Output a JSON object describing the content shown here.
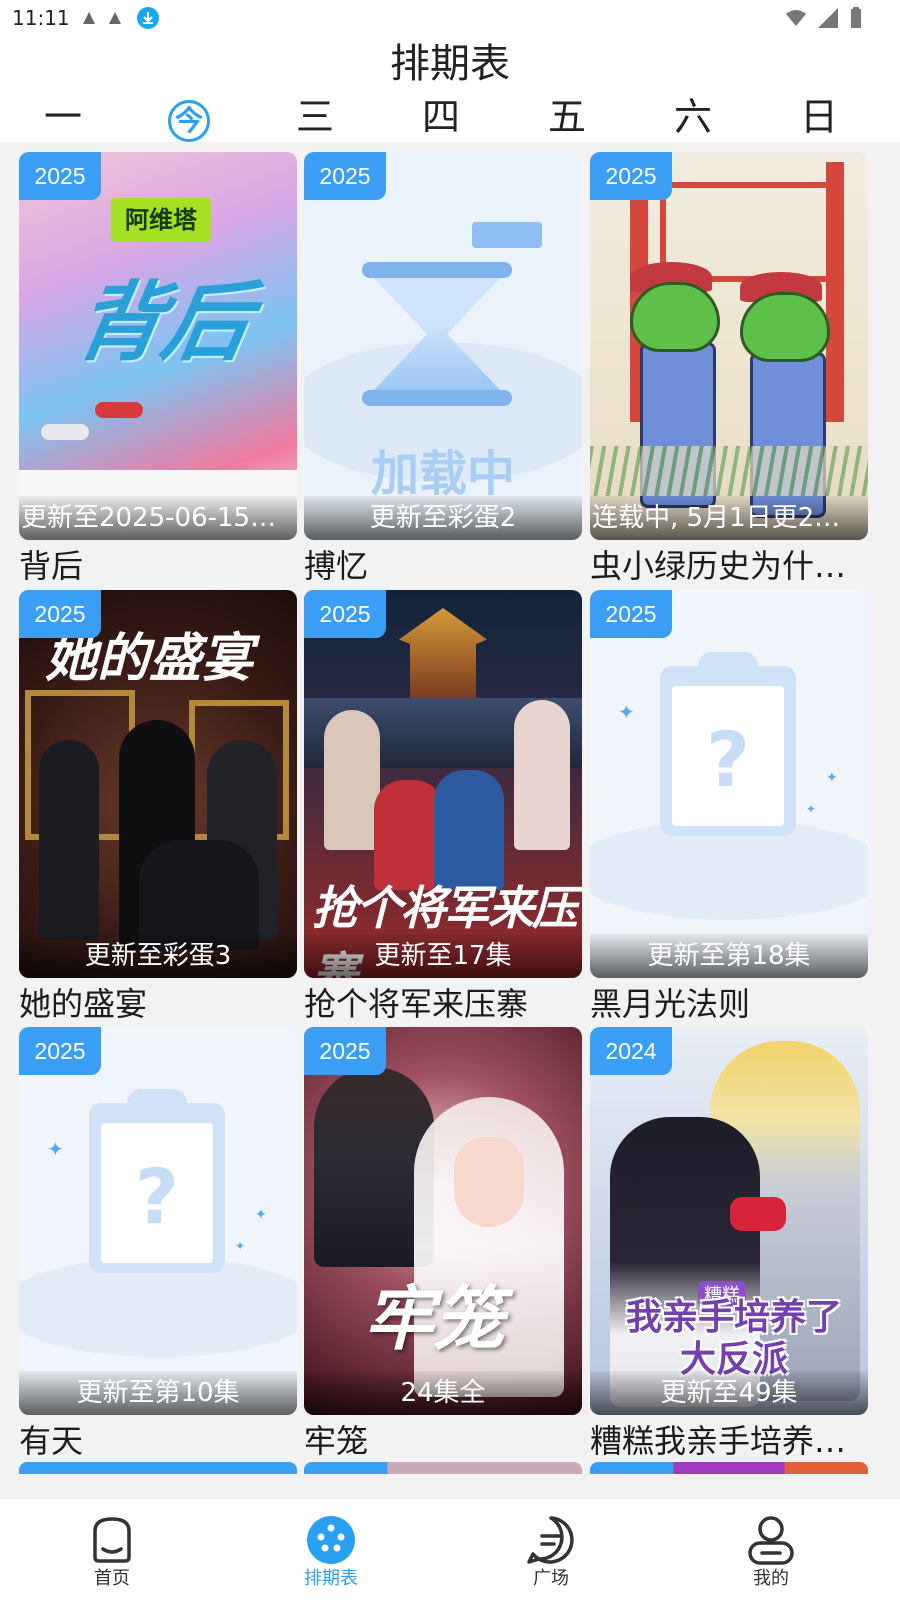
{
  "status_bar": {
    "time": "11:11"
  },
  "header": {
    "title": "排期表",
    "days": [
      {
        "label": "一",
        "active": false
      },
      {
        "label": "今",
        "active": true
      },
      {
        "label": "三",
        "active": false
      },
      {
        "label": "四",
        "active": false
      },
      {
        "label": "五",
        "active": false
      },
      {
        "label": "六",
        "active": false
      },
      {
        "label": "日",
        "active": false
      }
    ]
  },
  "cards": [
    {
      "year": "2025",
      "update": "更新至2025-06-15…",
      "title": "背后",
      "art": "backstory",
      "art_text": {
        "logo": "阿维塔",
        "big": "背后"
      }
    },
    {
      "year": "2025",
      "update": "更新至彩蛋2",
      "title": "搏忆",
      "art": "loading",
      "art_text": {
        "loading": "加载中"
      }
    },
    {
      "year": "2025",
      "update": "连载中, 5月1日更2…",
      "title": "虫小绿历史为什…",
      "art": "bug"
    },
    {
      "year": "2025",
      "update": "更新至彩蛋3",
      "title": "她的盛宴",
      "art": "banquet",
      "art_text": {
        "cal": "她的盛宴"
      }
    },
    {
      "year": "2025",
      "update": "更新至17集",
      "title": "抢个将军来压寨",
      "art": "general",
      "art_text": {
        "cal": "抢个将军来压寨"
      }
    },
    {
      "year": "2025",
      "update": "更新至第18集",
      "title": "黑月光法则",
      "art": "placeholder"
    },
    {
      "year": "2025",
      "update": "更新至第10集",
      "title": "有天",
      "art": "placeholder"
    },
    {
      "year": "2025",
      "update": "24集全",
      "title": "牢笼",
      "art": "cage",
      "art_text": {
        "cal": "牢笼"
      }
    },
    {
      "year": "2024",
      "update": "更新至49集",
      "title": "糟糕我亲手培养…",
      "art": "villain",
      "art_text": {
        "tag": "糟糕",
        "cal": "我亲手培养了大反派"
      }
    }
  ],
  "bottom_nav": [
    {
      "label": "首页",
      "icon": "home-icon",
      "active": false
    },
    {
      "label": "排期表",
      "icon": "schedule-icon",
      "active": true
    },
    {
      "label": "广场",
      "icon": "square-chat-icon",
      "active": false
    },
    {
      "label": "我的",
      "icon": "profile-icon",
      "active": false
    }
  ],
  "colors": {
    "accent": "#2aa0f2",
    "badge": "#3a9ef5",
    "background": "#f2f2f2"
  }
}
